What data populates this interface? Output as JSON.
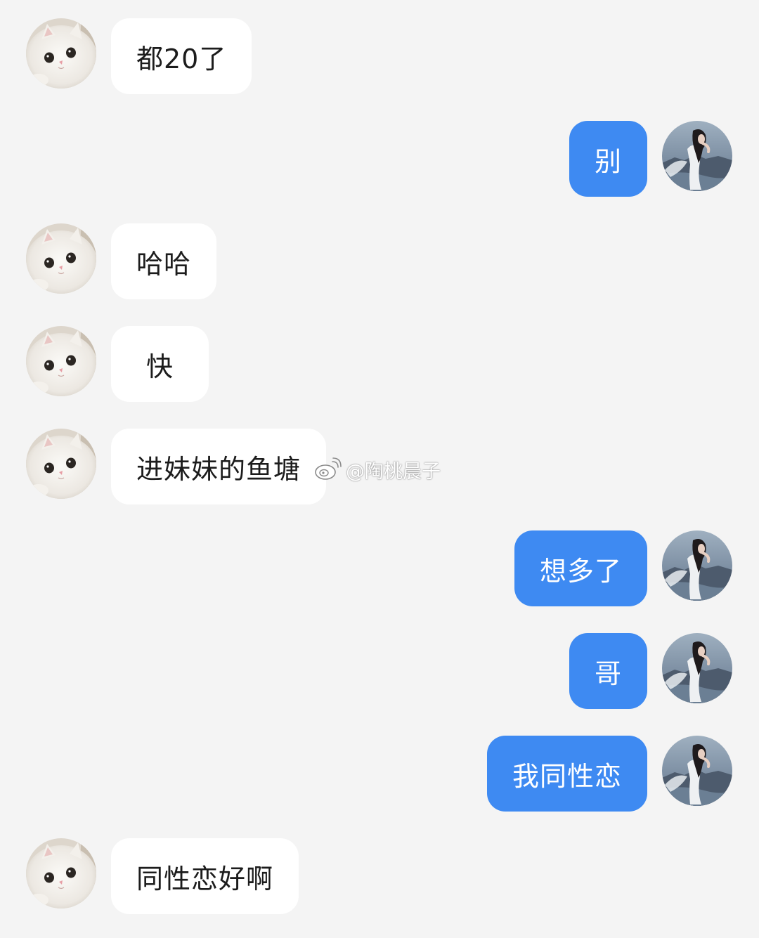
{
  "messages": [
    {
      "side": "in",
      "text": "都20了"
    },
    {
      "side": "out",
      "text": "别"
    },
    {
      "side": "in",
      "text": "哈哈"
    },
    {
      "side": "in",
      "text": "快"
    },
    {
      "side": "in",
      "text": "进妹妹的鱼塘"
    },
    {
      "side": "out",
      "text": "想多了"
    },
    {
      "side": "out",
      "text": "哥"
    },
    {
      "side": "out",
      "text": "我同性恋"
    },
    {
      "side": "in",
      "text": "同性恋好啊"
    }
  ],
  "watermark": {
    "icon": "weibo-logo-icon",
    "text": "@陶桃晨子"
  },
  "colors": {
    "background": "#f4f4f4",
    "incoming_bubble": "#ffffff",
    "outgoing_bubble": "#3e8af2",
    "incoming_text": "#1c1c1c",
    "outgoing_text": "#ffffff"
  }
}
